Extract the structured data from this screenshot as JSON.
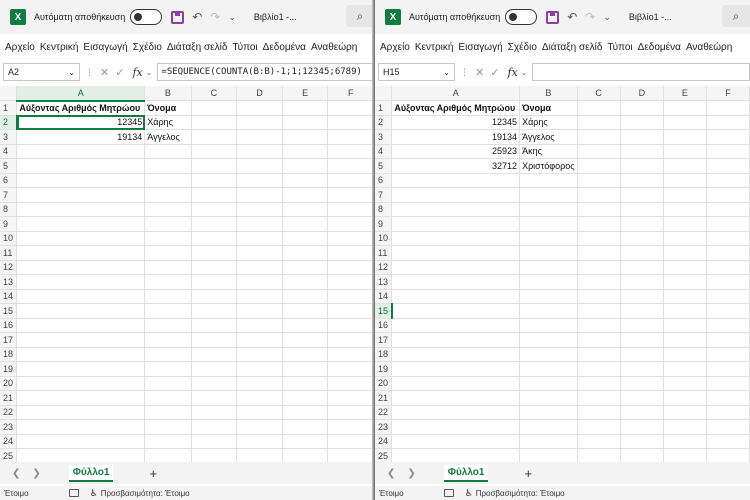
{
  "left": {
    "title": {
      "autosave_label": "Αυτόματη αποθήκευση",
      "workbook_name": "Βιβλίο1 -..."
    },
    "ribbon_tabs": [
      "Αρχείο",
      "Κεντρική",
      "Εισαγωγή",
      "Σχέδιο",
      "Διάταξη σελίδ",
      "Τύποι",
      "Δεδομένα",
      "Αναθεώρη"
    ],
    "namebox": "A2",
    "formula": "=SEQUENCE(COUNTA(B:B)-1;1;12345;6789)",
    "columns": [
      "A",
      "B",
      "C",
      "D",
      "E",
      "F"
    ],
    "rows": [
      [
        "Αύξοντας Αριθμός Μητρώου",
        "Όνομα",
        "",
        "",
        "",
        ""
      ],
      [
        "12345",
        "Χάρης",
        "",
        "",
        "",
        ""
      ],
      [
        "19134",
        "Άγγελος",
        "",
        "",
        "",
        ""
      ]
    ],
    "row_count": 25,
    "sheet_tab": "Φύλλο1",
    "status": {
      "ready": "Έτοιμο",
      "accessibility": "Προσβασιμότητα: Έτοιμο"
    }
  },
  "right": {
    "title": {
      "autosave_label": "Αυτόματη αποθήκευση",
      "workbook_name": "Βιβλίο1 -..."
    },
    "ribbon_tabs": [
      "Αρχείο",
      "Κεντρική",
      "Εισαγωγή",
      "Σχέδιο",
      "Διάταξη σελίδ",
      "Τύποι",
      "Δεδομένα",
      "Αναθεώρη"
    ],
    "namebox": "H15",
    "formula": "",
    "columns": [
      "A",
      "B",
      "C",
      "D",
      "E",
      "F"
    ],
    "rows": [
      [
        "Αύξοντας Αριθμός Μητρώου",
        "Όνομα",
        "",
        "",
        "",
        ""
      ],
      [
        "12345",
        "Χάρης",
        "",
        "",
        "",
        ""
      ],
      [
        "19134",
        "Άγγελος",
        "",
        "",
        "",
        ""
      ],
      [
        "25923",
        "Άκης",
        "",
        "",
        "",
        ""
      ],
      [
        "32712",
        "Χριστόφορος",
        "",
        "",
        "",
        ""
      ]
    ],
    "row_count": 25,
    "sheet_tab": "Φύλλο1",
    "status": {
      "ready": "Έτοιμο",
      "accessibility": "Προσβασιμότητα: Έτοιμο"
    }
  },
  "colors": {
    "excel_green": "#107c41",
    "save_purple": "#8a3ea8"
  },
  "icons": [
    "excel-logo-icon",
    "save-icon",
    "undo-icon",
    "redo-icon",
    "customize-icon",
    "search-icon",
    "cancel-icon",
    "enter-icon",
    "fx-icon",
    "sheet-prev-icon",
    "sheet-next-icon",
    "add-sheet-icon",
    "status-view-icon",
    "accessibility-icon"
  ]
}
